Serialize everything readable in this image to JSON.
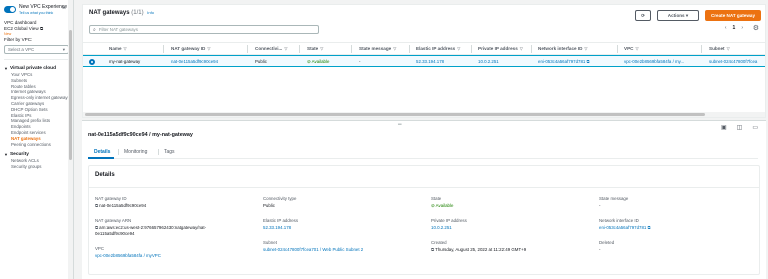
{
  "sidebar": {
    "new_vpc_title": "New VPC Experience",
    "tell_us": "Tell us what you think",
    "vpc_dashboard": "VPC dashboard",
    "ec2_global_view": "EC2 Global View",
    "new_badge": "New",
    "filter_label": "Filter by VPC:",
    "filter_placeholder": "Select a VPC",
    "section_vpc": "Virtual private cloud",
    "items": [
      "Your VPCs",
      "Subnets",
      "Route tables",
      "Internet gateways",
      "Egress-only internet gateways",
      "Carrier gateways",
      "DHCP Option Sets",
      "Elastic IPs",
      "Managed prefix lists",
      "Endpoints",
      "Endpoint services",
      "NAT gateways",
      "Peering connections"
    ],
    "section_security": "Security",
    "security_items": [
      "Network ACLs",
      "Security groups"
    ]
  },
  "list": {
    "title": "NAT gateways",
    "count": "(1/1)",
    "info": "Info",
    "actions_label": "Actions",
    "create_label": "Create NAT gateway",
    "search_placeholder": "Filter NAT gateways",
    "page": "1",
    "columns": [
      "Name",
      "NAT gateway ID",
      "Connectivi...",
      "State",
      "State message",
      "Elastic IP address",
      "Private IP address",
      "Network interface ID",
      "VPC",
      "Subnet"
    ],
    "row": {
      "name": "my-nat-gateway",
      "id": "nat-0e115a5df9c90ce94",
      "connectivity": "Public",
      "state": "Available",
      "state_message": "-",
      "elastic_ip": "52.33.194.178",
      "private_ip": "10.0.2.251",
      "eni": "eni-053c4a56af797d781",
      "vpc": "vpc-00e2b8569bfa584fa / my...",
      "subnet": "subnet-024c47800f7fcea"
    }
  },
  "detail": {
    "title": "nat-0e115a5df9c90ce94 / my-nat-gateway",
    "tabs": [
      "Details",
      "Monitoring",
      "Tags"
    ],
    "card_title": "Details",
    "fields": {
      "id_label": "NAT gateway ID",
      "id_value": "nat-0e115a5df9c90ce94",
      "arn_label": "NAT gateway ARN",
      "arn_value_1": "arn:aws:ec2:us-west-2:976657962430:natgateway/nat-",
      "arn_value_2": "0e115a5df9c90ce94",
      "vpc_label": "VPC",
      "vpc_value": "vpc-00e2b8569bfa584fa / myVPC",
      "conn_label": "Connectivity type",
      "conn_value": "Public",
      "eip_label": "Elastic IP address",
      "eip_value": "52.33.194.178",
      "subnet_label": "Subnet",
      "subnet_value": "subnet-024c47800f7fcea701 / Web Public Subnet 2",
      "state_label": "State",
      "state_value": "Available",
      "pip_label": "Private IP address",
      "pip_value": "10.0.2.251",
      "created_label": "Created",
      "created_value": "Thursday, August 25, 2022 at 11:22:49 GMT+9",
      "msg_label": "State message",
      "msg_value": "-",
      "eni_label": "Network interface ID",
      "eni_value": "eni-053c4a56af797d781",
      "deleted_label": "Deleted",
      "deleted_value": "-"
    }
  },
  "colors": {
    "accent": "#0073bb",
    "primary_button": "#ec7211",
    "success": "#1d8102"
  }
}
